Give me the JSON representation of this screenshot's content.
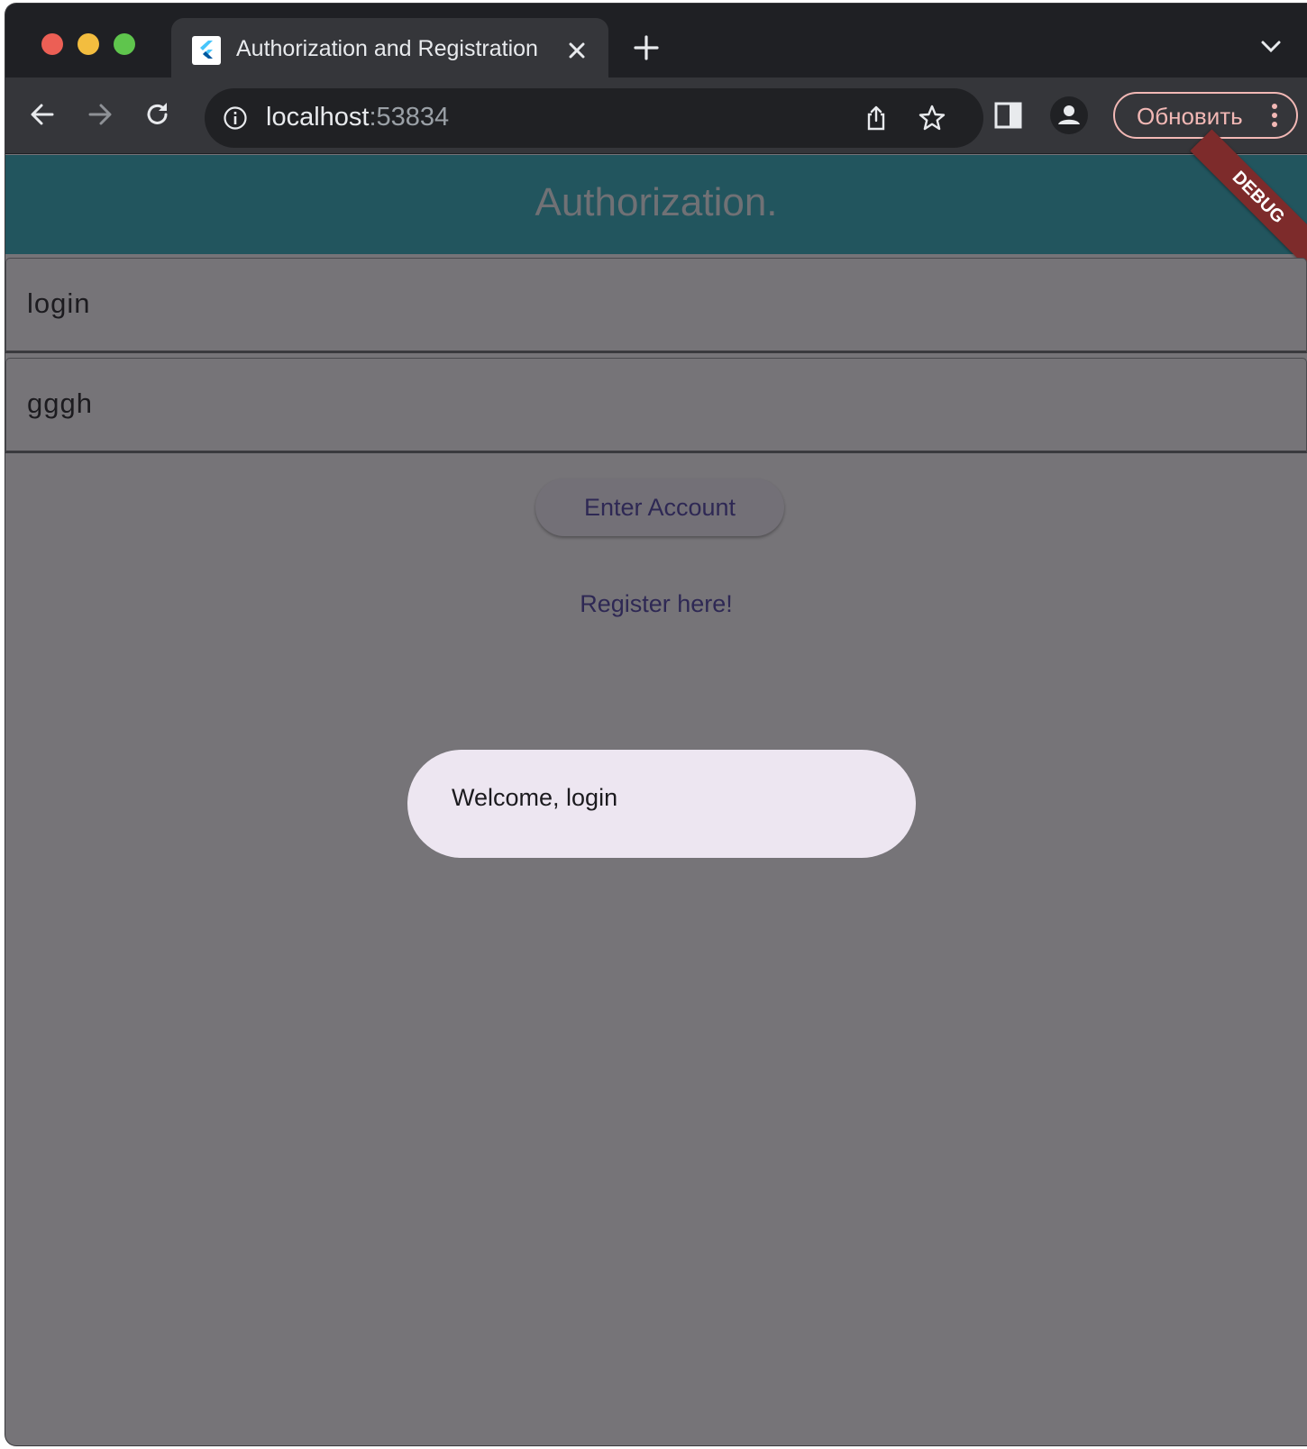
{
  "browser": {
    "tab": {
      "title": "Authorization and Registration",
      "favicon": "flutter-logo-icon"
    },
    "address": {
      "host": "localhost",
      "port": ":53834"
    },
    "update_button_label": "Обновить"
  },
  "app": {
    "title": "Authorization.",
    "debug_banner": "DEBUG",
    "login_field": {
      "value": "login"
    },
    "password_field": {
      "value": "gggh"
    },
    "enter_button_label": "Enter Account",
    "register_link_label": "Register here!",
    "snackbar_message": "Welcome, login"
  },
  "colors": {
    "appbar": "#22555e",
    "scrim_background": "#767478",
    "snackbar": "#ede6f1",
    "button_text": "#2e2854",
    "debug_banner": "#7d2b2b"
  }
}
